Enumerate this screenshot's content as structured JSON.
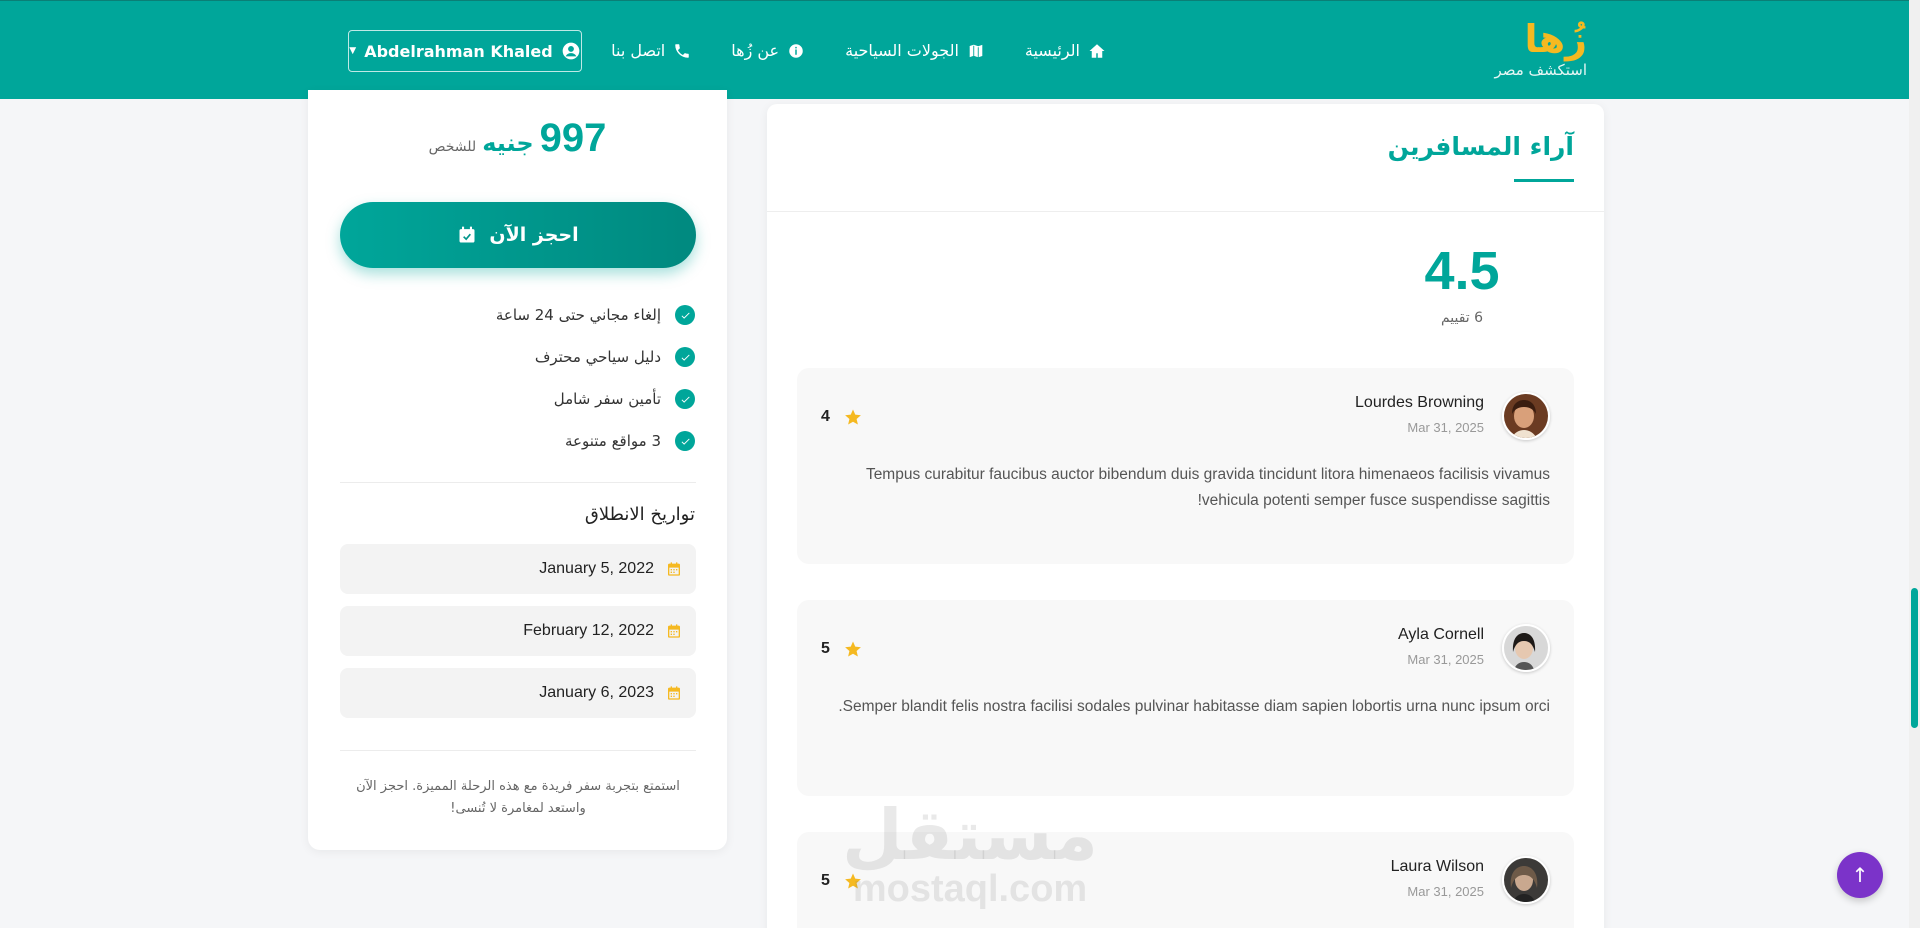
{
  "brand": {
    "name": "زُها",
    "tagline": "استكشف مصر"
  },
  "nav": {
    "items": [
      {
        "label": "الرئيسية",
        "icon": "home-icon"
      },
      {
        "label": "الجولات السياحية",
        "icon": "map-icon"
      },
      {
        "label": "عن زُها",
        "icon": "info-icon"
      },
      {
        "label": "اتصل بنا",
        "icon": "phone-icon"
      }
    ],
    "user": "Abdelrahman Khaled"
  },
  "booking": {
    "price": "997",
    "currency": "جنيه",
    "per": "للشخص",
    "book_label": "احجز الآن",
    "features": [
      "إلغاء مجاني حتى 24 ساعة",
      "دليل سياحي محترف",
      "تأمين سفر شامل",
      "3 مواقع متنوعة"
    ],
    "dates_title": "تواريخ الانطلاق",
    "dates": [
      "January 5, 2022",
      "February 12, 2022",
      "January 6, 2023"
    ],
    "note": "استمتع بتجربة سفر فريدة مع هذه الرحلة المميزة. احجز الآن واستعد لمغامرة لا تُنسى!"
  },
  "reviews": {
    "title": "آراء المسافرين",
    "average": "4.5",
    "count_label": "6 تقييم",
    "items": [
      {
        "name": "Lourdes Browning",
        "date": "Mar 31, 2025",
        "rating": "4",
        "text": "Tempus curabitur faucibus auctor bibendum duis gravida tincidunt litora himenaeos facilisis vivamus vehicula potenti semper fusce suspendisse sagittis!"
      },
      {
        "name": "Ayla Cornell",
        "date": "Mar 31, 2025",
        "rating": "5",
        "text": "Semper blandit felis nostra facilisi sodales pulvinar habitasse diam sapien lobortis urna nunc ipsum orci."
      },
      {
        "name": "Laura Wilson",
        "date": "Mar 31, 2025",
        "rating": "5",
        "text": ""
      }
    ]
  },
  "watermark": {
    "arabic": "مستقل",
    "latin": "mostaql.com"
  },
  "scroll_top_label": "↑",
  "colors": {
    "primary": "#00a69a",
    "accent": "#f5b921",
    "fab": "#7b33c9"
  }
}
